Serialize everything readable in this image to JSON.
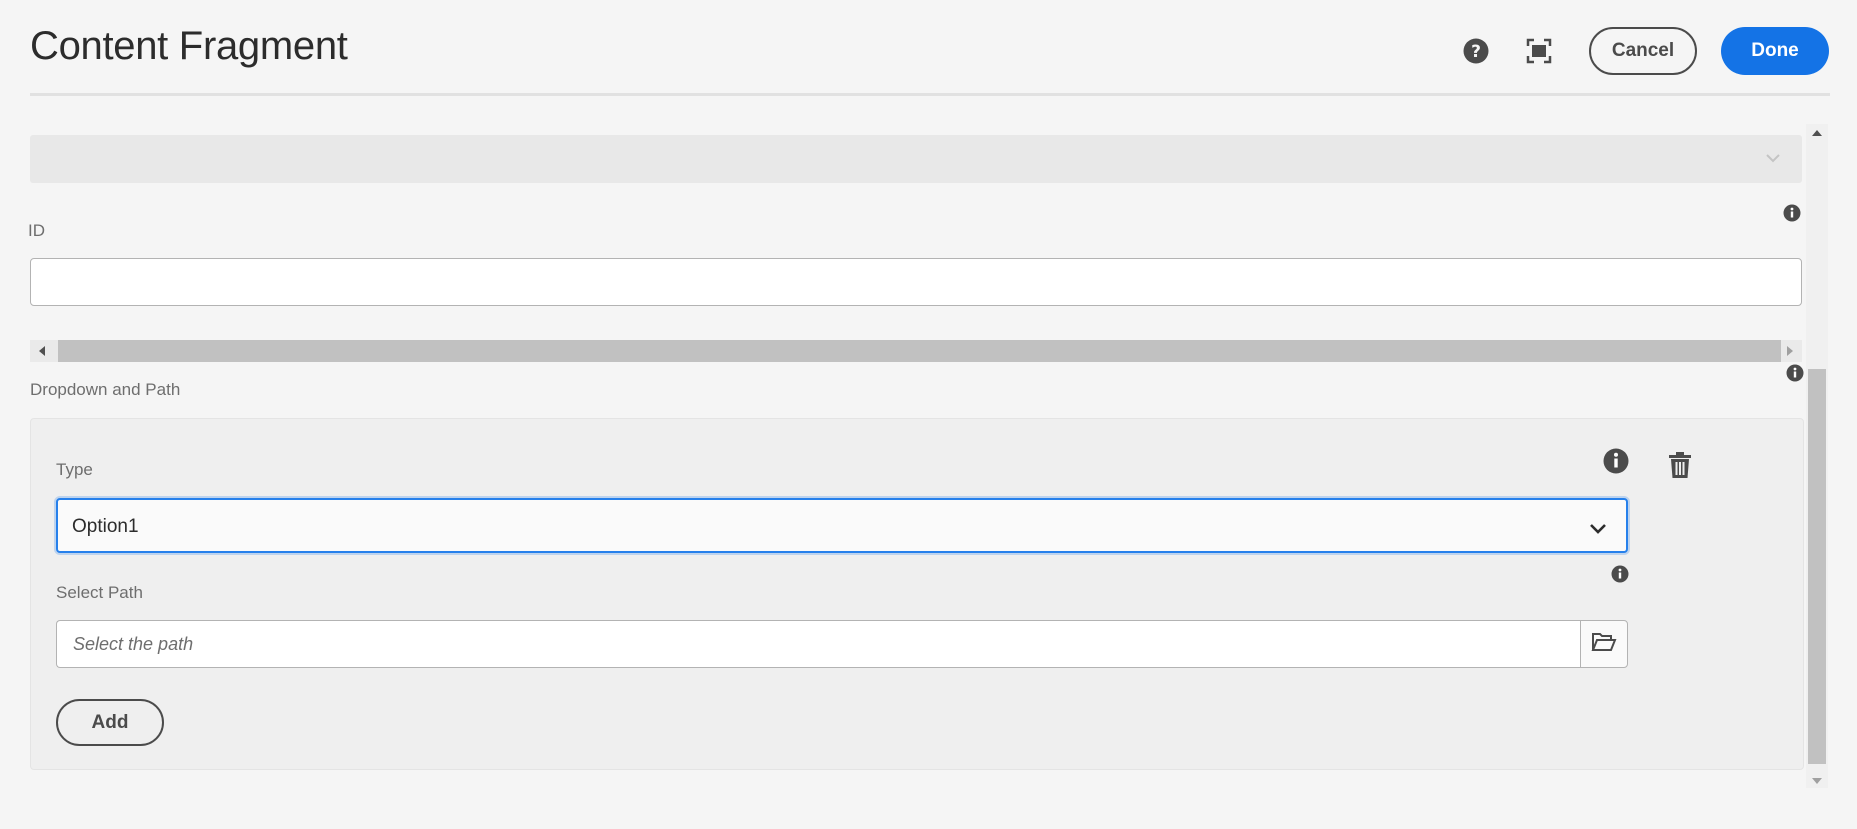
{
  "header": {
    "title": "Content Fragment",
    "help_icon": "help-circle-icon",
    "fullscreen_icon": "fullscreen-icon",
    "cancel_label": "Cancel",
    "done_label": "Done"
  },
  "form": {
    "id_field": {
      "label": "ID",
      "value": ""
    },
    "multifield": {
      "label": "Dropdown and Path",
      "type_label": "Type",
      "type_value": "Option1",
      "path_label": "Select Path",
      "path_placeholder": "Select the path",
      "add_label": "Add"
    }
  },
  "colors": {
    "accent": "#1473e6",
    "focus_ring": "#2680eb",
    "background": "#f5f5f5"
  }
}
